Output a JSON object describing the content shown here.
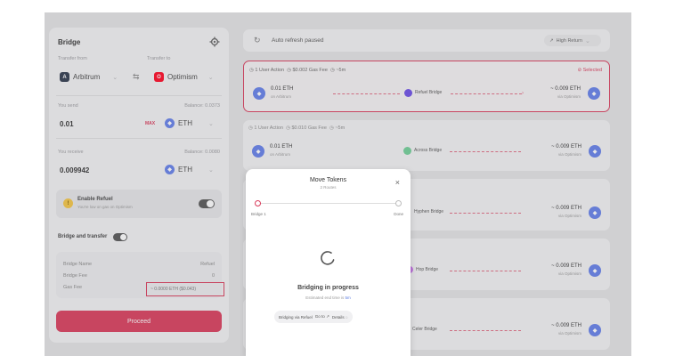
{
  "left": {
    "title": "Bridge",
    "transfer_from_label": "Transfer from",
    "transfer_to_label": "Transfer to",
    "from_chain": "Arbitrum",
    "to_chain": "Optimism",
    "send_label": "You send",
    "send_balance": "Balance: 0.0373",
    "send_amount": "0.01",
    "max_label": "MAX",
    "send_token": "ETH",
    "receive_label": "You receive",
    "receive_balance": "Balance: 0.0080",
    "receive_amount": "0.009942",
    "receive_token": "ETH",
    "refuel_title": "Enable Refuel",
    "refuel_sub": "You're low on gas on Optimism",
    "bridge_transfer_label": "Bridge and transfer",
    "details": [
      {
        "label": "Bridge Name",
        "value": "Refuel"
      },
      {
        "label": "Bridge Fee",
        "value": "0"
      },
      {
        "label": "Gas Fee",
        "value": "~ 0.0000 ETH ($0.043)"
      }
    ],
    "proceed_label": "Proceed"
  },
  "topbar": {
    "auto_refresh": "Auto refresh paused",
    "sort": "High Return"
  },
  "routes": [
    {
      "meta": "1 User Action",
      "gas": "$0.002 Gas Fee",
      "time": "~5m",
      "amount_from": "0.01 ETH",
      "chain_from": "on Arbitrum",
      "bridge": "Refuel Bridge",
      "amount_to": "~ 0.009 ETH",
      "chain_to": "via Optimism",
      "selected_label": "Selected"
    },
    {
      "meta": "1 User Action",
      "gas": "$0.010 Gas Fee",
      "time": "~5m",
      "amount_from": "0.01 ETH",
      "chain_from": "on Arbitrum",
      "bridge": "Across Bridge",
      "amount_to": "~ 0.009 ETH",
      "chain_to": "via Optimism"
    },
    {
      "bridge": "Hyphen Bridge",
      "amount_to": "~ 0.009 ETH",
      "chain_to": "via Optimism"
    },
    {
      "bridge": "Hop Bridge",
      "amount_to": "~ 0.009 ETH",
      "chain_to": "via Optimism"
    },
    {
      "bridge": "Celer Bridge",
      "amount_to": "~ 0.009 ETH",
      "chain_to": "via Optimism"
    }
  ],
  "modal": {
    "title": "Move Tokens",
    "subtitle": "2 Routes",
    "step_left": "Bridge",
    "step_left_badge": "1",
    "step_right": "Done",
    "status_title": "Bridging in progress",
    "status_sub_prefix": "Estimated end time is",
    "status_sub_time": "5m",
    "pill_via": "Bridging via Refuel",
    "pill_go": "Go to",
    "pill_details": "Details"
  },
  "colors": {
    "accent": "#d93a5a",
    "eth_blue": "#627eea",
    "arbitrum": "#28a0f0",
    "optimism": "#ff0420",
    "refuel_purple": "#6b4ce6",
    "warning_yellow": "#f5c542"
  }
}
